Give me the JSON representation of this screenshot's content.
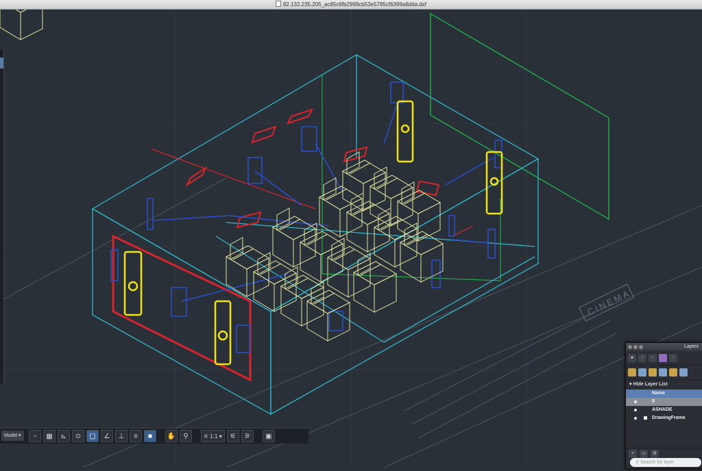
{
  "window": {
    "title": "82.132.235.205_ac85c6fb2999cb53e5785cf6399a8dda.dxf"
  },
  "statusbar": {
    "model_label": "Model",
    "scale_label": "1:1",
    "icons": [
      "paper-icon",
      "grid-icon",
      "snap-icon",
      "ortho-icon",
      "polar-icon",
      "object-snap-icon",
      "dynamic-ucs-icon",
      "lineweight-icon",
      "transparency-icon",
      "pan-icon",
      "zoom-icon",
      "annotation-scale-icon",
      "workspace-icon",
      "fullscreen-icon"
    ]
  },
  "layers_panel": {
    "title": "Layers",
    "hide_layer_list": "Hide Layer List",
    "column_name": "Name",
    "layers": [
      {
        "name": "0"
      },
      {
        "name": "ASHADE"
      },
      {
        "name": "DrawingFrame"
      }
    ],
    "search_placeholder": "Search for layer"
  },
  "drawing": {
    "watermark_text": "CINEMA"
  },
  "colors": {
    "background": "#2a3038",
    "room": "#2fb6c9",
    "seats": "#dfe3a0",
    "speakers_blue": "#2a4fd0",
    "speakers_yellow": "#f2e600",
    "red": "#d8242c",
    "green": "#22a84a"
  }
}
